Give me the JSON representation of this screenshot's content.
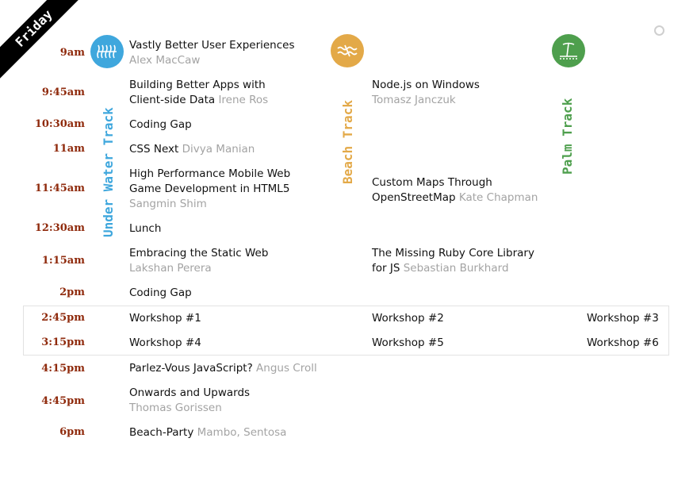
{
  "day": "Friday",
  "tracks": {
    "water": {
      "label": "Under Water Track",
      "color": "#3fa7dd",
      "icon": "water-wave-icon"
    },
    "beach": {
      "label": "Beach Track",
      "color": "#e3a948",
      "icon": "beach-wave-icon"
    },
    "palm": {
      "label": "Palm Track",
      "color": "#4e9f4d",
      "icon": "palm-tree-icon"
    }
  },
  "times": [
    "9am",
    "9:45am",
    "10:30am",
    "11am",
    "11:45am",
    "12:30am",
    "1:15am",
    "2pm",
    "2:45pm",
    "3:15pm",
    "4:15pm",
    "4:45pm",
    "6pm"
  ],
  "sessions": {
    "s1": {
      "title": "Vastly Better User Experiences",
      "speaker": "Alex MacCaw"
    },
    "s2a": {
      "title_l1": "Building Better Apps with",
      "title_l2": "Client-side Data",
      "speaker": "Irene Ros"
    },
    "s2b": {
      "title": "Node.js on Windows",
      "speaker": "Tomasz Janczuk"
    },
    "s3": {
      "title": "Coding Gap"
    },
    "s4": {
      "title": "CSS Next",
      "speaker": "Divya Manian"
    },
    "s5a": {
      "title_l1": "High Performance Mobile Web",
      "title_l2": "Game Development in HTML5",
      "speaker": "Sangmin Shim"
    },
    "s5b": {
      "title_l1": "Custom Maps Through",
      "title_l2": "OpenStreetMap",
      "speaker": "Kate Chapman"
    },
    "s6": {
      "title": "Lunch"
    },
    "s7a": {
      "title": "Embracing the Static Web",
      "speaker": "Lakshan Perera"
    },
    "s7b": {
      "title_l1": "The Missing Ruby Core Library",
      "title_l2": "for JS",
      "speaker": "Sebastian Burkhard"
    },
    "s8": {
      "title": "Coding Gap"
    },
    "w1": {
      "title": "Workshop #1"
    },
    "w2": {
      "title": "Workshop #2"
    },
    "w3": {
      "title": "Workshop #3"
    },
    "w4": {
      "title": "Workshop #4"
    },
    "w5": {
      "title": "Workshop #5"
    },
    "w6": {
      "title": "Workshop #6"
    },
    "s10": {
      "title": "Parlez-Vous JavaScript?",
      "speaker": "Angus Croll"
    },
    "s11": {
      "title": "Onwards and Upwards",
      "speaker": "Thomas Gorissen"
    },
    "s12": {
      "title": "Beach-Party",
      "speaker": "Mambo, Sentosa"
    }
  }
}
